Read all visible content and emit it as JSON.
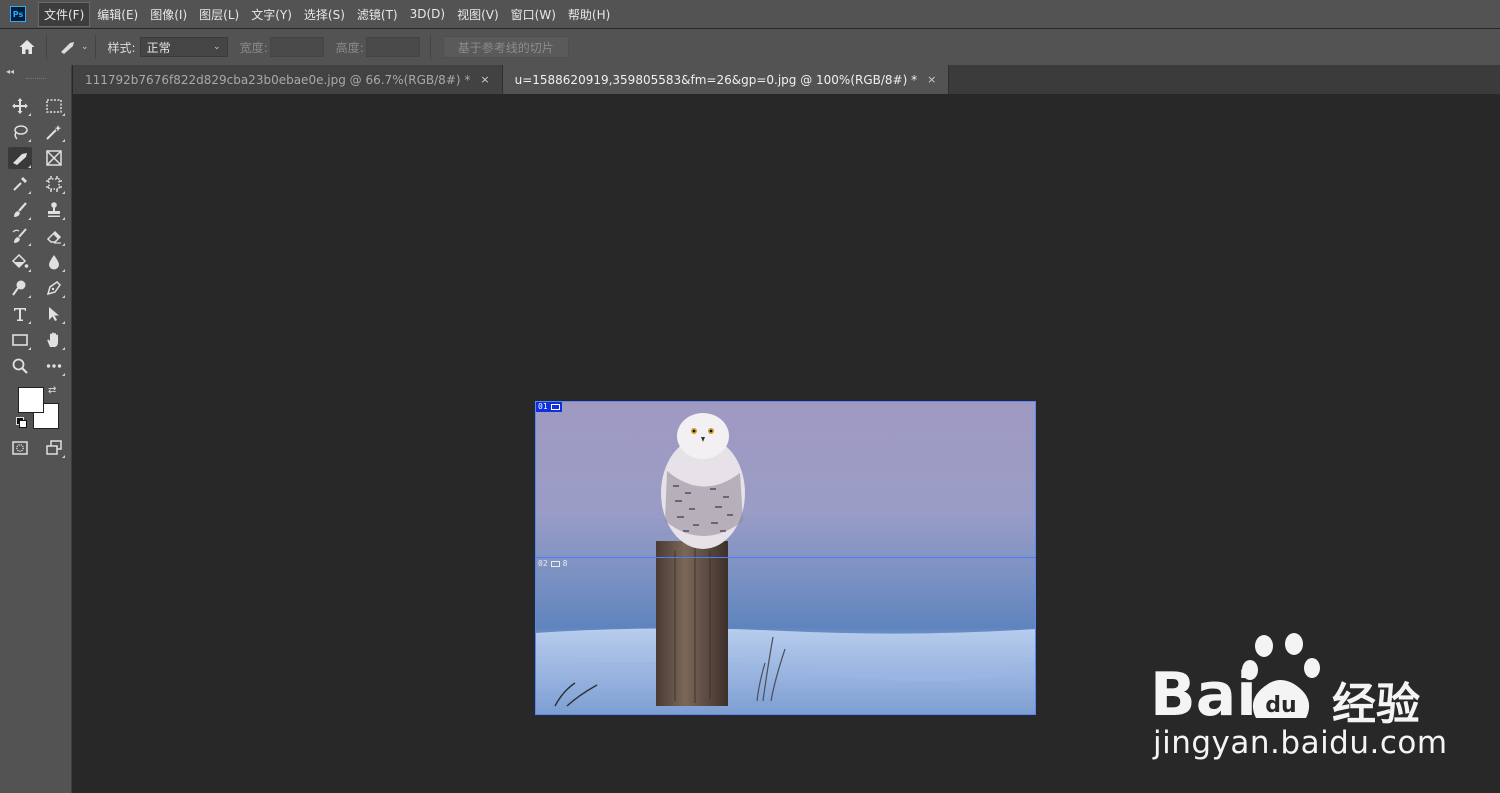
{
  "app": {
    "logo": "Ps"
  },
  "menu": [
    "文件(F)",
    "编辑(E)",
    "图像(I)",
    "图层(L)",
    "文字(Y)",
    "选择(S)",
    "滤镜(T)",
    "3D(D)",
    "视图(V)",
    "窗口(W)",
    "帮助(H)"
  ],
  "options": {
    "style_label": "样式:",
    "style_value": "正常",
    "width_label": "宽度:",
    "height_label": "高度:",
    "slice_button": "基于参考线的切片"
  },
  "tabs": [
    {
      "label": "111792b7676f822d829cba23b0ebae0e.jpg @ 66.7%(RGB/8#) *",
      "close": "×"
    },
    {
      "label": "u=1588620919,359805583&fm=26&gp=0.jpg @ 100%(RGB/8#) *",
      "close": "×"
    }
  ],
  "slices": [
    {
      "label": "01"
    },
    {
      "label": "02",
      "extra": "8"
    }
  ],
  "colors": {
    "foreground": "#ffffff",
    "background": "#ffffff"
  },
  "watermark": {
    "brand_left": "Bai",
    "brand_right": "经验",
    "url": "jingyan.baidu.com"
  },
  "tools": [
    "move-icon",
    "marquee-icon",
    "lasso-icon",
    "magic-wand-icon",
    "slice-icon",
    "frame-icon",
    "eyedropper-icon",
    "crop-icon",
    "brush-icon",
    "stamp-icon",
    "history-brush-icon",
    "eraser-icon",
    "paint-bucket-icon",
    "blur-icon",
    "dodge-icon",
    "pen-icon",
    "type-icon",
    "path-select-icon",
    "rectangle-icon",
    "hand-icon",
    "zoom-icon",
    "more-icon"
  ]
}
